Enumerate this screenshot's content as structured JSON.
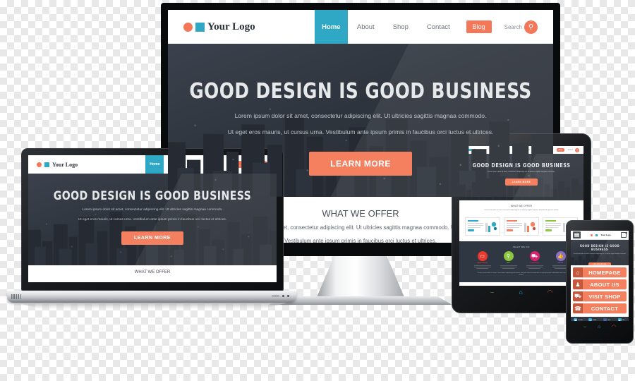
{
  "scene": {
    "description": "Responsive web design mockup shown on four devices",
    "background": "transparent-checkerboard"
  },
  "brand": {
    "logo_text": "Your Logo",
    "accent_orange": "#f4805f",
    "accent_teal": "#2ea8c4",
    "dark": "#2f3842",
    "logo_circle_icon": "circle-icon",
    "logo_square_icon": "square-icon"
  },
  "nav": {
    "items": [
      {
        "label": "Home",
        "style": "active"
      },
      {
        "label": "About",
        "style": "plain"
      },
      {
        "label": "Shop",
        "style": "plain"
      },
      {
        "label": "Contact",
        "style": "plain"
      },
      {
        "label": "Blog",
        "style": "pill"
      }
    ],
    "search_label": "Search",
    "search_icon": "magnifier-icon"
  },
  "hero": {
    "headline": "GOOD DESIGN IS GOOD BUSINESS",
    "paragraph_line1": "Lorem ipsum dolor sit amet, consectetur adipiscing elit. Ut ultricies sagittis magnaa commodo.",
    "paragraph_line2": "Ut eget eros mauris, ut cursus urna. Vestibulum ante ipsum primis in faucibus orci luctus et ultrices.",
    "cta_label": "LEARN MORE"
  },
  "offer": {
    "heading": "WHAT WE OFFER",
    "paragraph_line1": "Lorem ipsum dolor sit amet, consectetur adipiscing elit. Ut ultricies sagittis magnaa commodo. Ut eget eros mauris.",
    "paragraph_line2": "Vestibulum ante ipsum primis in faucibus orci luctus et ultrices."
  },
  "tablet": {
    "cards": [
      {
        "accent": "#2ea8c4"
      },
      {
        "accent": "#f4805f"
      },
      {
        "accent": "#8cc63f"
      }
    ],
    "dark_section_heading": "WHAT WE DO",
    "features": [
      {
        "label": "WEB DESIGN",
        "icon": "monitor-icon",
        "glyph": "▭",
        "color": "#e8392f"
      },
      {
        "label": "SEO",
        "icon": "magnifier-icon",
        "glyph": "⚲",
        "color": "#8cc63f"
      },
      {
        "label": "COMMERCE",
        "icon": "cart-icon",
        "glyph": "⛟",
        "color": "#d6246e"
      },
      {
        "label": "SOCIAL",
        "icon": "thumbs-up-icon",
        "glyph": "☝",
        "color": "#8a6fc4"
      }
    ],
    "quote": "\"Lorem ipsum dolor sit amet, consectetur adipiscing elit mauris suscipit et lorem commodo suscipit gravamid sollicitudin enim sed nullam\"",
    "nav_buttons": [
      {
        "name": "back-button",
        "glyph": "⌒",
        "color": "#4caf50"
      },
      {
        "name": "home-button",
        "glyph": "⌂",
        "color": "#29a8d8"
      },
      {
        "name": "recents-button",
        "glyph": "◠",
        "color": "#d9534f"
      }
    ]
  },
  "phone": {
    "menu_icon": "hamburger-icon",
    "share_icon": "share-icon",
    "menu_items": [
      {
        "label": "HOMEPAGE",
        "icon": "home-icon",
        "glyph": "⌂"
      },
      {
        "label": "ABOUT US",
        "icon": "person-icon",
        "glyph": "♟"
      },
      {
        "label": "VISIT SHOP",
        "icon": "cart-icon",
        "glyph": "⛟"
      },
      {
        "label": "CONTACT",
        "icon": "phone-icon",
        "glyph": "☎"
      }
    ],
    "social": [
      {
        "label": "PHONE",
        "icon": "phone-icon",
        "glyph": "☎",
        "color": "#29a8d8"
      },
      {
        "label": "EMAIL",
        "icon": "mail-icon",
        "glyph": "✉",
        "color": "#29a8d8"
      },
      {
        "label": "LIKE",
        "icon": "facebook-icon",
        "glyph": "f",
        "color": "#3b5998"
      },
      {
        "label": "RSS",
        "icon": "rss-icon",
        "glyph": "◉",
        "color": "#29a8d8"
      }
    ],
    "nav_buttons": [
      {
        "name": "back-button",
        "glyph": "⌒",
        "color": "#4caf50"
      },
      {
        "name": "home-button",
        "glyph": "⌂",
        "color": "#29a8d8"
      },
      {
        "name": "recents-button",
        "glyph": "◠",
        "color": "#d9534f"
      }
    ]
  }
}
